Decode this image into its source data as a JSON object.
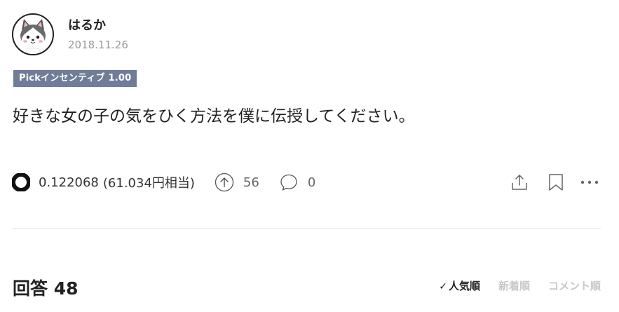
{
  "user": {
    "name": "はるか",
    "date": "2018.11.26",
    "avatar_icon": "husky-dog-avatar"
  },
  "badge": {
    "label": "Pickインセンティブ 1.00"
  },
  "question": {
    "text": "好きな女の子の気をひく方法を僕に伝授してください。"
  },
  "stats": {
    "coin_icon": "coin-icon",
    "reward_amount": "0.122068",
    "reward_jpy": "(61.034円相当)",
    "upvote_icon": "upvote-arrow-icon",
    "upvote_count": "56",
    "comment_icon": "comment-bubble-icon",
    "comment_count": "0"
  },
  "actions": {
    "share_icon": "share-icon",
    "bookmark_icon": "bookmark-icon",
    "more_icon": "more-icon"
  },
  "answers": {
    "title": "回答 48",
    "sort_options": [
      {
        "label": "人気順",
        "active": true
      },
      {
        "label": "新着順",
        "active": false
      },
      {
        "label": "コメント順",
        "active": false
      }
    ]
  }
}
